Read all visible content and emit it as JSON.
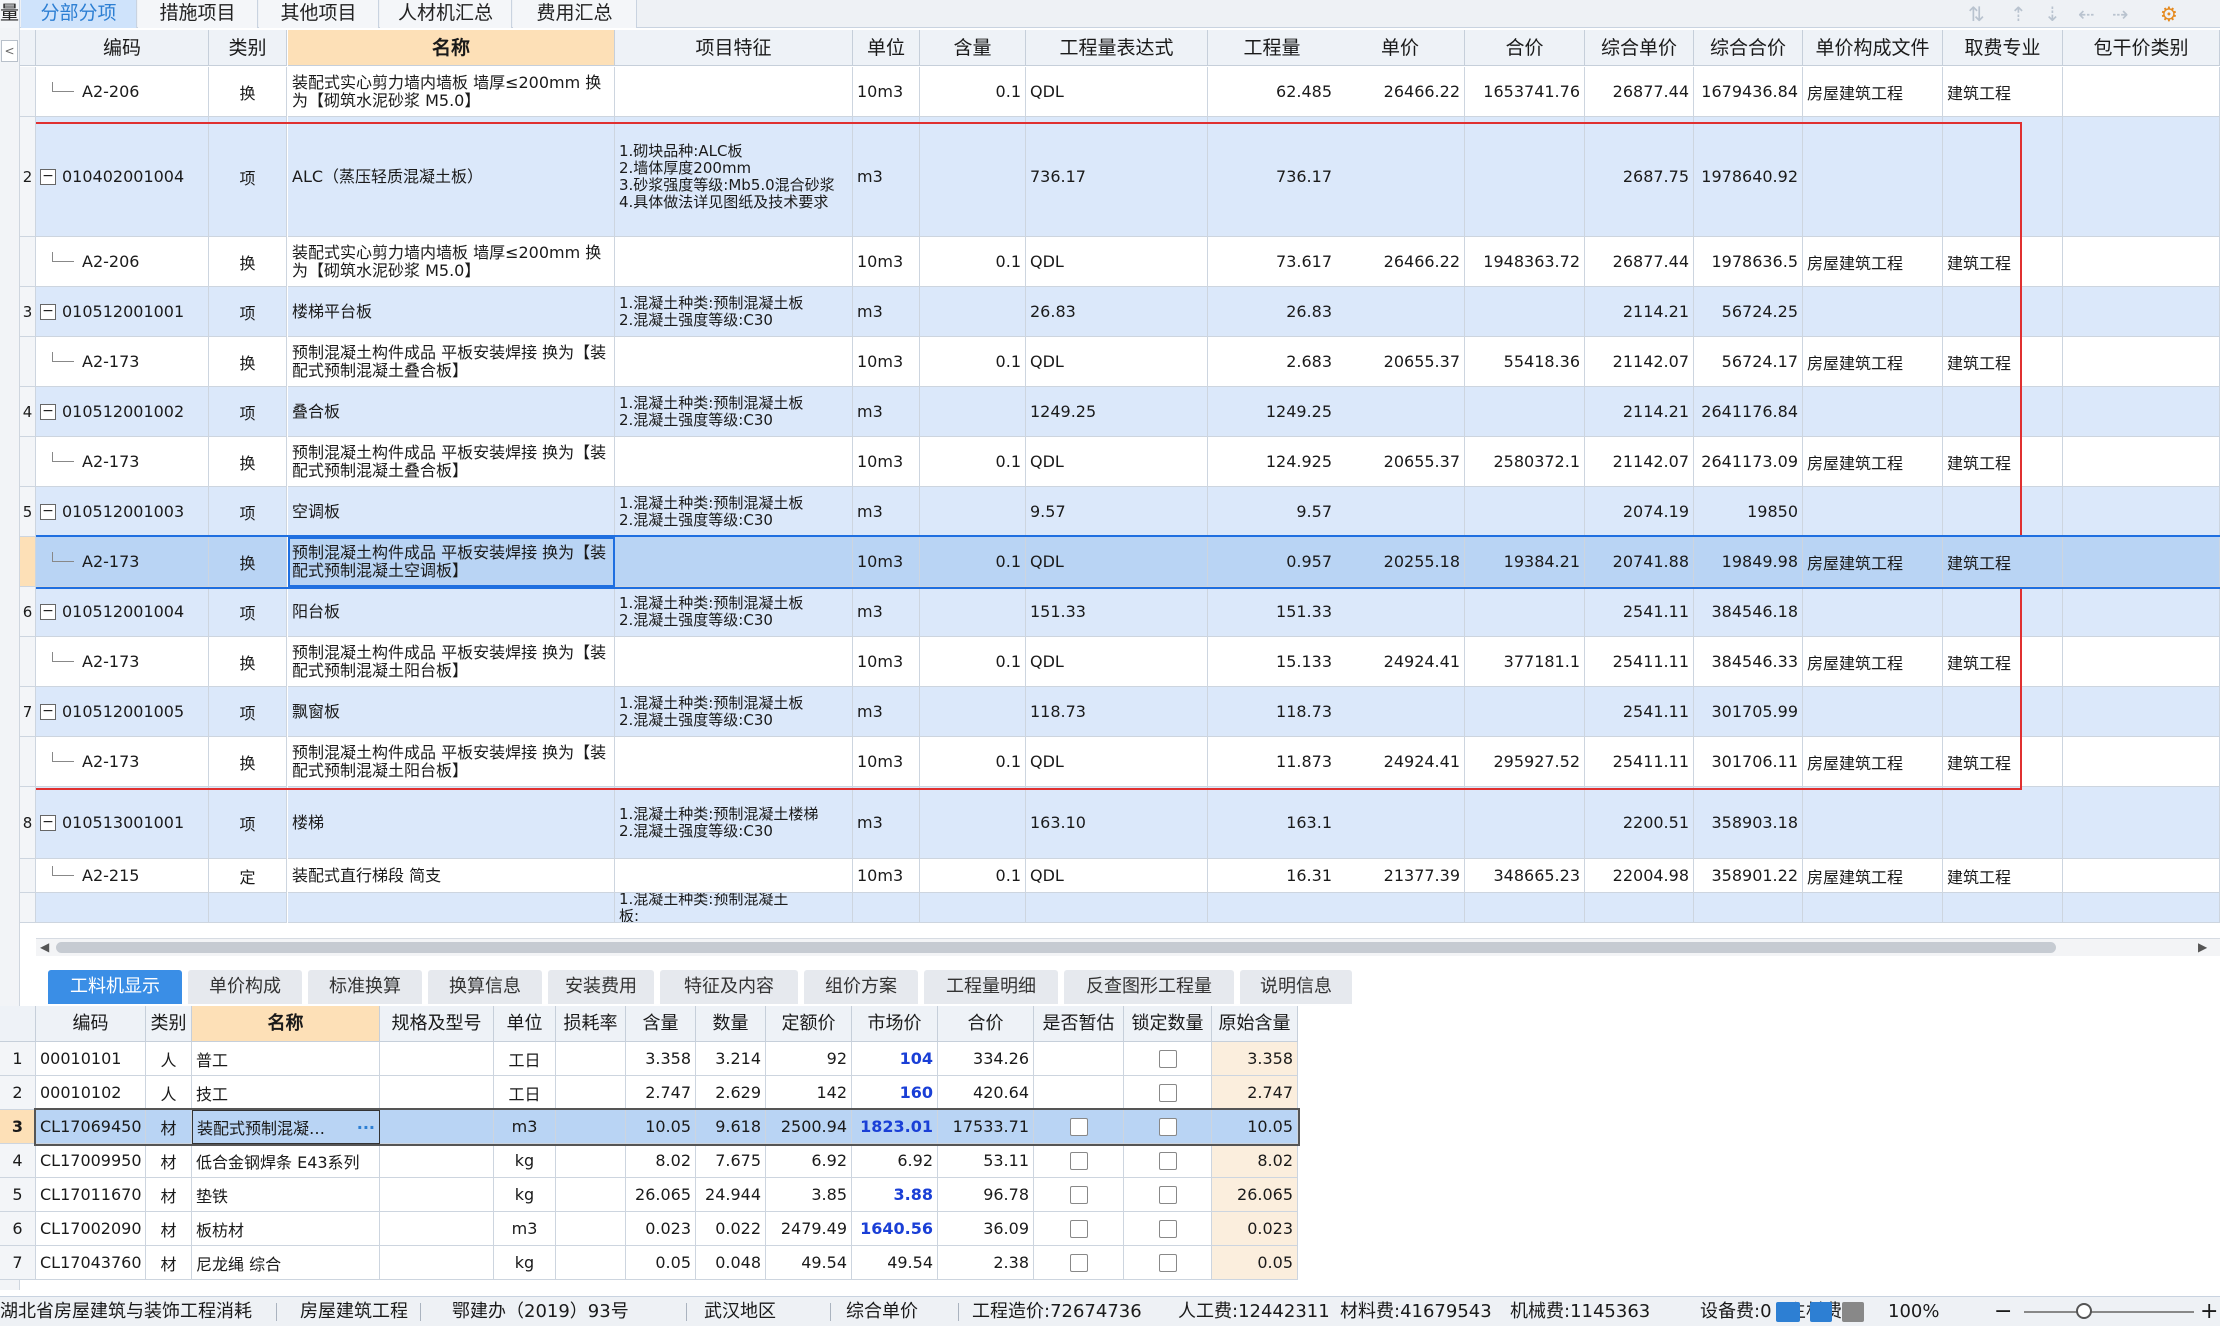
{
  "top_tabs": [
    "分部分项",
    "措施项目",
    "其他项目",
    "人材机汇总",
    "费用汇总"
  ],
  "top_tab_prefix": "量",
  "main_headers": [
    "编码",
    "类别",
    "名称",
    "项目特征",
    "单位",
    "含量",
    "工程量表达式",
    "工程量",
    "单价",
    "合价",
    "综合单价",
    "综合合价",
    "单价构成文件",
    "取费专业",
    "包干价类别"
  ],
  "main_rows": [
    {
      "num": "",
      "code": "A2-206",
      "sub": true,
      "type": "换",
      "name": "装配式实心剪力墙内墙板 墙厚≤200mm 换为【砌筑水泥砂浆 M5.0】",
      "feature": "",
      "unit": "10m3",
      "content": "0.1",
      "expr": "QDL",
      "qty": "62.485",
      "price": "26466.22",
      "total": "1653741.76",
      "cprice": "26877.44",
      "ctotal": "1679436.84",
      "file": "房屋建筑工程",
      "major": "建筑工程"
    },
    {
      "num": "2",
      "code": "010402001004",
      "sub": false,
      "type": "项",
      "name": "ALC（蒸压轻质混凝土板）",
      "feature": "1.砌块品种:ALC板\n2.墙体厚度200mm\n3.砂浆强度等级:Mb5.0混合砂浆\n4.具体做法详见图纸及技术要求",
      "unit": "m3",
      "content": "",
      "expr": "736.17",
      "qty": "736.17",
      "price": "",
      "total": "",
      "cprice": "2687.75",
      "ctotal": "1978640.92",
      "file": "",
      "major": ""
    },
    {
      "num": "",
      "code": "A2-206",
      "sub": true,
      "type": "换",
      "name": "装配式实心剪力墙内墙板 墙厚≤200mm 换为【砌筑水泥砂浆 M5.0】",
      "feature": "",
      "unit": "10m3",
      "content": "0.1",
      "expr": "QDL",
      "qty": "73.617",
      "price": "26466.22",
      "total": "1948363.72",
      "cprice": "26877.44",
      "ctotal": "1978636.5",
      "file": "房屋建筑工程",
      "major": "建筑工程"
    },
    {
      "num": "3",
      "code": "010512001001",
      "sub": false,
      "type": "项",
      "name": "楼梯平台板",
      "feature": "1.混凝土种类:预制混凝土板\n2.混凝土强度等级:C30",
      "unit": "m3",
      "content": "",
      "expr": "26.83",
      "qty": "26.83",
      "price": "",
      "total": "",
      "cprice": "2114.21",
      "ctotal": "56724.25",
      "file": "",
      "major": ""
    },
    {
      "num": "",
      "code": "A2-173",
      "sub": true,
      "type": "换",
      "name": "预制混凝土构件成品 平板安装焊接  换为【装配式预制混凝土叠合板】",
      "feature": "",
      "unit": "10m3",
      "content": "0.1",
      "expr": "QDL",
      "qty": "2.683",
      "price": "20655.37",
      "total": "55418.36",
      "cprice": "21142.07",
      "ctotal": "56724.17",
      "file": "房屋建筑工程",
      "major": "建筑工程"
    },
    {
      "num": "4",
      "code": "010512001002",
      "sub": false,
      "type": "项",
      "name": "叠合板",
      "feature": "1.混凝土种类:预制混凝土板\n2.混凝土强度等级:C30",
      "unit": "m3",
      "content": "",
      "expr": "1249.25",
      "qty": "1249.25",
      "price": "",
      "total": "",
      "cprice": "2114.21",
      "ctotal": "2641176.84",
      "file": "",
      "major": ""
    },
    {
      "num": "",
      "code": "A2-173",
      "sub": true,
      "type": "换",
      "name": "预制混凝土构件成品 平板安装焊接  换为【装配式预制混凝土叠合板】",
      "feature": "",
      "unit": "10m3",
      "content": "0.1",
      "expr": "QDL",
      "qty": "124.925",
      "price": "20655.37",
      "total": "2580372.1",
      "cprice": "21142.07",
      "ctotal": "2641173.09",
      "file": "房屋建筑工程",
      "major": "建筑工程"
    },
    {
      "num": "5",
      "code": "010512001003",
      "sub": false,
      "type": "项",
      "name": "空调板",
      "feature": "1.混凝土种类:预制混凝土板\n2.混凝土强度等级:C30",
      "unit": "m3",
      "content": "",
      "expr": "9.57",
      "qty": "9.57",
      "price": "",
      "total": "",
      "cprice": "2074.19",
      "ctotal": "19850",
      "file": "",
      "major": ""
    },
    {
      "num": "",
      "code": "A2-173",
      "sub": true,
      "type": "换",
      "name": "预制混凝土构件成品 平板安装焊接  换为【装配式预制混凝土空调板】",
      "feature": "",
      "unit": "10m3",
      "content": "0.1",
      "expr": "QDL",
      "qty": "0.957",
      "price": "20255.18",
      "total": "19384.21",
      "cprice": "20741.88",
      "ctotal": "19849.98",
      "file": "房屋建筑工程",
      "major": "建筑工程",
      "selected": true
    },
    {
      "num": "6",
      "code": "010512001004",
      "sub": false,
      "type": "项",
      "name": "阳台板",
      "feature": "1.混凝土种类:预制混凝土板\n2.混凝土强度等级:C30",
      "unit": "m3",
      "content": "",
      "expr": "151.33",
      "qty": "151.33",
      "price": "",
      "total": "",
      "cprice": "2541.11",
      "ctotal": "384546.18",
      "file": "",
      "major": ""
    },
    {
      "num": "",
      "code": "A2-173",
      "sub": true,
      "type": "换",
      "name": "预制混凝土构件成品 平板安装焊接  换为【装配式预制混凝土阳台板】",
      "feature": "",
      "unit": "10m3",
      "content": "0.1",
      "expr": "QDL",
      "qty": "15.133",
      "price": "24924.41",
      "total": "377181.1",
      "cprice": "25411.11",
      "ctotal": "384546.33",
      "file": "房屋建筑工程",
      "major": "建筑工程"
    },
    {
      "num": "7",
      "code": "010512001005",
      "sub": false,
      "type": "项",
      "name": "飘窗板",
      "feature": "1.混凝土种类:预制混凝土板\n2.混凝土强度等级:C30",
      "unit": "m3",
      "content": "",
      "expr": "118.73",
      "qty": "118.73",
      "price": "",
      "total": "",
      "cprice": "2541.11",
      "ctotal": "301705.99",
      "file": "",
      "major": ""
    },
    {
      "num": "",
      "code": "A2-173",
      "sub": true,
      "type": "换",
      "name": "预制混凝土构件成品 平板安装焊接  换为【装配式预制混凝土阳台板】",
      "feature": "",
      "unit": "10m3",
      "content": "0.1",
      "expr": "QDL",
      "qty": "11.873",
      "price": "24924.41",
      "total": "295927.52",
      "cprice": "25411.11",
      "ctotal": "301706.11",
      "file": "房屋建筑工程",
      "major": "建筑工程"
    },
    {
      "num": "8",
      "code": "010513001001",
      "sub": false,
      "type": "项",
      "name": "楼梯",
      "feature": "1.混凝土种类:预制混凝土楼梯\n2.混凝土强度等级:C30",
      "unit": "m3",
      "content": "",
      "expr": "163.10",
      "qty": "163.1",
      "price": "",
      "total": "",
      "cprice": "2200.51",
      "ctotal": "358903.18",
      "file": "",
      "major": ""
    },
    {
      "num": "",
      "code": "A2-215",
      "sub": true,
      "type": "定",
      "name": "装配式直行梯段 简支",
      "feature": "",
      "unit": "10m3",
      "content": "0.1",
      "expr": "QDL",
      "qty": "16.31",
      "price": "21377.39",
      "total": "348665.23",
      "cprice": "22004.98",
      "ctotal": "358901.22",
      "file": "房屋建筑工程",
      "major": "建筑工程"
    },
    {
      "num": "",
      "code": "",
      "sub": false,
      "type": "",
      "name": "",
      "feature": "1.混凝土种类:预制混凝土\n板:",
      "unit": "",
      "content": "",
      "expr": "",
      "qty": "",
      "price": "",
      "total": "",
      "cprice": "",
      "ctotal": "",
      "file": "",
      "major": ""
    }
  ],
  "bottom_tabs": [
    "工料机显示",
    "单价构成",
    "标准换算",
    "换算信息",
    "安装费用",
    "特征及内容",
    "组价方案",
    "工程量明细",
    "反查图形工程量",
    "说明信息"
  ],
  "bottom_headers": [
    "编码",
    "类别",
    "名称",
    "规格及型号",
    "单位",
    "损耗率",
    "含量",
    "数量",
    "定额价",
    "市场价",
    "合价",
    "是否暂估",
    "锁定数量",
    "原始含量"
  ],
  "bottom_rows": [
    {
      "num": "1",
      "code": "00010101",
      "type": "人",
      "name": "普工",
      "spec": "",
      "unit": "工日",
      "loss": "",
      "content": "3.358",
      "qty": "3.214",
      "base": "92",
      "market": "104",
      "total": "334.26",
      "est": false,
      "lock": true,
      "orig": "3.358"
    },
    {
      "num": "2",
      "code": "00010102",
      "type": "人",
      "name": "技工",
      "spec": "",
      "unit": "工日",
      "loss": "",
      "content": "2.747",
      "qty": "2.629",
      "base": "142",
      "market": "160",
      "total": "420.64",
      "est": false,
      "lock": true,
      "orig": "2.747"
    },
    {
      "num": "3",
      "code": "CL17069450",
      "type": "材",
      "name": "装配式预制混凝…",
      "spec": "",
      "unit": "m3",
      "loss": "",
      "content": "10.05",
      "qty": "9.618",
      "base": "2500.94",
      "market": "1823.01",
      "total": "17533.71",
      "est": true,
      "lock": true,
      "orig": "10.05",
      "selected": true
    },
    {
      "num": "4",
      "code": "CL17009950",
      "type": "材",
      "name": "低合金钢焊条 E43系列",
      "spec": "",
      "unit": "kg",
      "loss": "",
      "content": "8.02",
      "qty": "7.675",
      "base": "6.92",
      "market": "6.92",
      "total": "53.11",
      "est": true,
      "lock": true,
      "orig": "8.02"
    },
    {
      "num": "5",
      "code": "CL17011670",
      "type": "材",
      "name": "垫铁",
      "spec": "",
      "unit": "kg",
      "loss": "",
      "content": "26.065",
      "qty": "24.944",
      "base": "3.85",
      "market": "3.88",
      "total": "96.78",
      "est": true,
      "lock": true,
      "orig": "26.065"
    },
    {
      "num": "6",
      "code": "CL17002090",
      "type": "材",
      "name": "板枋材",
      "spec": "",
      "unit": "m3",
      "loss": "",
      "content": "0.023",
      "qty": "0.022",
      "base": "2479.49",
      "market": "1640.56",
      "total": "36.09",
      "est": true,
      "lock": true,
      "orig": "0.023"
    },
    {
      "num": "7",
      "code": "CL17043760",
      "type": "材",
      "name": "尼龙绳 综合",
      "spec": "",
      "unit": "kg",
      "loss": "",
      "content": "0.05",
      "qty": "0.048",
      "base": "49.54",
      "market": "49.54",
      "total": "2.38",
      "est": true,
      "lock": true,
      "orig": "0.05"
    }
  ],
  "market_blue": [
    "104",
    "160",
    "1823.01",
    "3.88",
    "1640.56"
  ],
  "status": {
    "items": [
      "湖北省房屋建筑与装饰工程消耗",
      "房屋建筑工程",
      "鄂建办（2019）93号",
      "武汉地区",
      "综合单价",
      "工程造价:72674736",
      "人工费:12442311",
      "材料费:41679543",
      "机械费:1145363",
      "设备费:0",
      "主材费:0"
    ],
    "zoom": "100%"
  },
  "colors": {
    "accent": "#3a8ee6",
    "selection_border": "#1f6fe0",
    "annotation": "#e03030",
    "blue_text": "#1a3fd6"
  }
}
